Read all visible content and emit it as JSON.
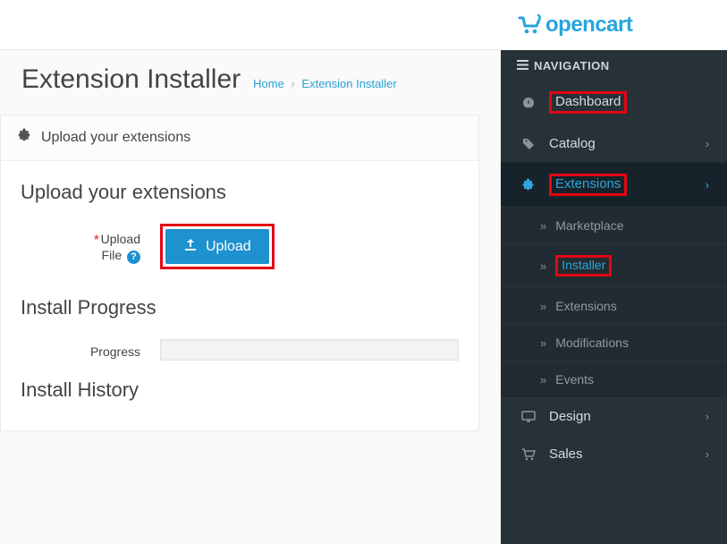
{
  "brand": "opencart",
  "nav_header": "NAVIGATION",
  "sidebar": {
    "dashboard": "Dashboard",
    "catalog": "Catalog",
    "extensions": "Extensions",
    "ext_children": {
      "marketplace": "Marketplace",
      "installer": "Installer",
      "extensions": "Extensions",
      "modifications": "Modifications",
      "events": "Events"
    },
    "design": "Design",
    "sales": "Sales"
  },
  "page": {
    "title": "Extension Installer",
    "breadcrumb": {
      "home": "Home",
      "current": "Extension Installer"
    }
  },
  "panel": {
    "title": "Upload your extensions",
    "upload_heading": "Upload your extensions",
    "upload_label_1": "Upload",
    "upload_label_2": "File",
    "upload_button": "Upload",
    "install_progress_heading": "Install Progress",
    "progress_label": "Progress",
    "history_heading": "Install History"
  }
}
